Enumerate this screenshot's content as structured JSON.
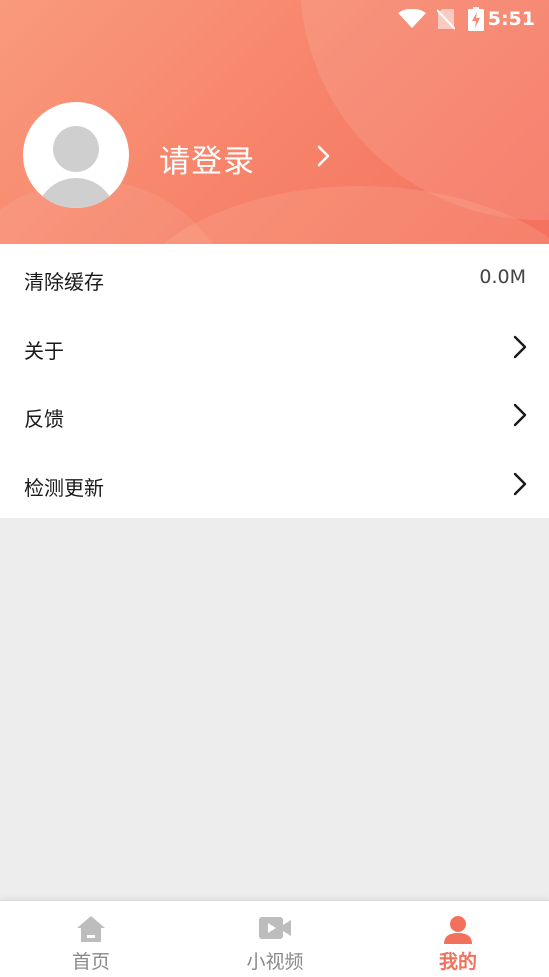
{
  "status_bar": {
    "time": "5:51"
  },
  "profile": {
    "login_prompt": "请登录"
  },
  "settings": [
    {
      "label": "清除缓存",
      "value": "0.0M"
    },
    {
      "label": "关于"
    },
    {
      "label": "反馈"
    },
    {
      "label": "检测更新"
    }
  ],
  "bottom_nav": [
    {
      "label": "首页",
      "icon": "home-icon"
    },
    {
      "label": "小视频",
      "icon": "video-camera-icon"
    },
    {
      "label": "我的",
      "icon": "person-icon",
      "active": true
    }
  ],
  "colors": {
    "accent": "#f2705c",
    "header_start": "#f99a7c",
    "header_end": "#f4715e"
  }
}
